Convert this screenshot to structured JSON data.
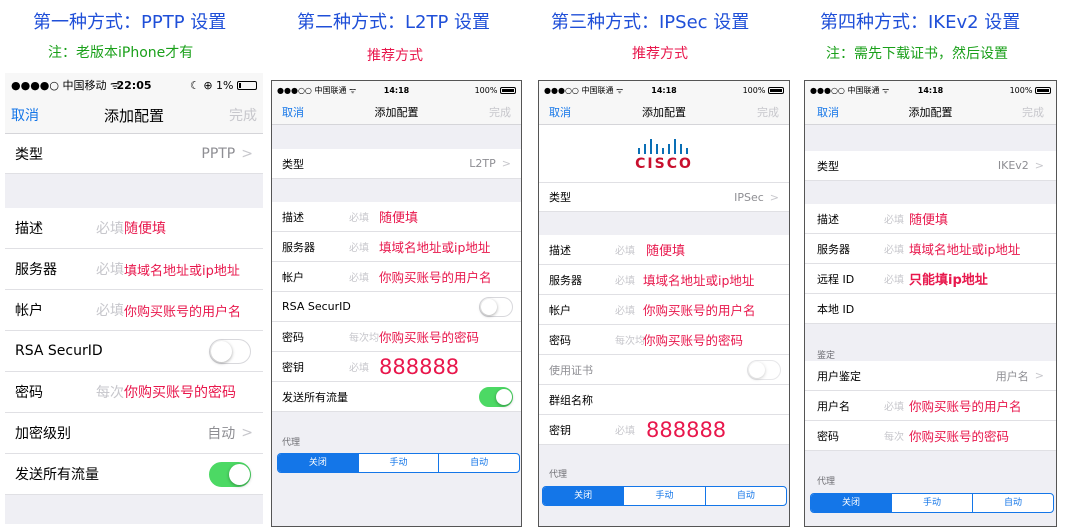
{
  "headers": [
    {
      "title": "第一种方式：PPTP 设置",
      "sub": "注：老版本iPhone才有",
      "sub_color": "#1aa01a"
    },
    {
      "title": "第二种方式：L2TP 设置",
      "sub": "推荐方式",
      "sub_color": "#e8174c"
    },
    {
      "title": "第三种方式：IPSec 设置",
      "sub": "推荐方式",
      "sub_color": "#e8174c"
    },
    {
      "title": "第四种方式：IKEv2 设置",
      "sub": "注：需先下载证书，然后设置",
      "sub_color": "#1aa01a"
    }
  ],
  "common": {
    "cancel": "取消",
    "nav_title": "添加配置",
    "done": "完成",
    "required": "必填",
    "every_time": "每次",
    "type_label": "类型",
    "desc_label": "描述",
    "server_label": "服务器",
    "account_label": "帐户",
    "password_label": "密码",
    "send_all_label": "发送所有流量",
    "proxy_label": "代理",
    "proxy_options": [
      "关闭",
      "手动",
      "自动"
    ],
    "random_fill": "随便填",
    "domain_fill": "填域名地址或ip地址",
    "username_fill": "你购买账号的用户名",
    "password_fill": "你购买账号的密码",
    "secret_label": "密钥",
    "secret_value": "888888",
    "rsa_label": "RSA SecurID",
    "chevron": ">"
  },
  "p1": {
    "signal": "●●●●○ 中国移动 ᯤ",
    "time": "22:05",
    "battery": "☾ ⊕ 1%",
    "type_value": "PPTP",
    "encryption_label": "加密级别",
    "encryption_value": "自动",
    "password_ph": "每次",
    "required_stub": "必填",
    "rsa_on": false,
    "send_all_on": true
  },
  "p2": {
    "signal": "●●●○○ 中国联通 ᯤ",
    "time": "14:18",
    "battery": "100%",
    "type_value": "L2TP",
    "password_ph": "每次均",
    "rsa_on": false,
    "send_all_on": true
  },
  "p3": {
    "signal": "●●●○○ 中国联通 ᯤ",
    "time": "14:18",
    "battery": "100%",
    "logo_text": "CISCO",
    "type_value": "IPSec",
    "password_ph": "每次均",
    "use_cert_label": "使用证书",
    "group_label": "群组名称",
    "use_cert_on": false
  },
  "p4": {
    "signal": "●●●○○ 中国联通 ᯤ",
    "time": "14:18",
    "battery": "100%",
    "type_value": "IKEv2",
    "remote_id_label": "远程 ID",
    "remote_id_fill": "只能填ip地址",
    "local_id_label": "本地 ID",
    "auth_section": "鉴定",
    "user_auth_label": "用户鉴定",
    "user_auth_value": "用户名",
    "username_label": "用户名"
  }
}
